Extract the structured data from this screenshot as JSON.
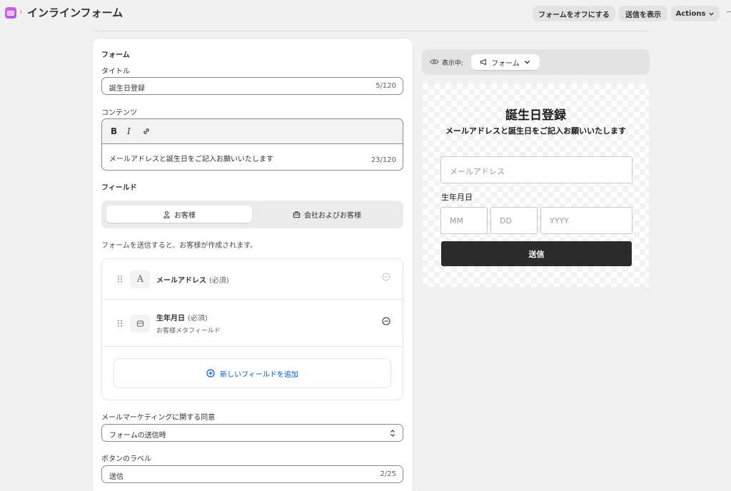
{
  "header": {
    "breadcrumb_separator": "›",
    "title": "インラインフォーム",
    "buttons": {
      "turn_off": "フォームをオフにする",
      "show_submissions": "送信を表示",
      "actions": "Actions"
    }
  },
  "form_panel": {
    "section_title": "フォーム",
    "title_label": "タイトル",
    "title_value": "誕生日登録",
    "title_count": "5/120",
    "content_label": "コンテンツ",
    "toolbar": {
      "bold": "B",
      "italic": "I"
    },
    "content_value": "メールアドレスと誕生日をご記入お願いいたします",
    "content_count": "23/120",
    "fields_label": "フィールド",
    "segments": [
      {
        "label": "お客様",
        "active": true,
        "icon": "person-icon"
      },
      {
        "label": "会社およびお客様",
        "active": false,
        "icon": "briefcase-icon"
      }
    ],
    "helper_text": "フォームを送信すると、お客様が作成されます。",
    "fields": [
      {
        "name": "メールアドレス",
        "required": "(必須)",
        "icon": "text-icon",
        "icon_glyph": "A"
      },
      {
        "name": "生年月日",
        "required": "(必須)",
        "subtitle": "お客様メタフィールド",
        "icon": "metafield-icon"
      }
    ],
    "add_field": "新しいフィールドを追加",
    "marketing_label": "メールマーケティングに関する同意",
    "marketing_value": "フォームの送信時",
    "button_label_label": "ボタンのラベル",
    "button_label_value": "送信",
    "button_label_count": "2/25"
  },
  "preview": {
    "showing_label": "表示中:",
    "view_select": "フォーム",
    "form": {
      "title": "誕生日登録",
      "description": "メールアドレスと誕生日をご記入お願いいたします",
      "email_placeholder": "メールアドレス",
      "birthday_label": "生年月日",
      "mm_placeholder": "MM",
      "dd_placeholder": "DD",
      "yyyy_placeholder": "YYYY",
      "submit": "送信"
    }
  },
  "colors": {
    "accent_link": "#005bd3",
    "app_icon": "#c45cf0",
    "submit_bg": "#2b2b2b"
  }
}
